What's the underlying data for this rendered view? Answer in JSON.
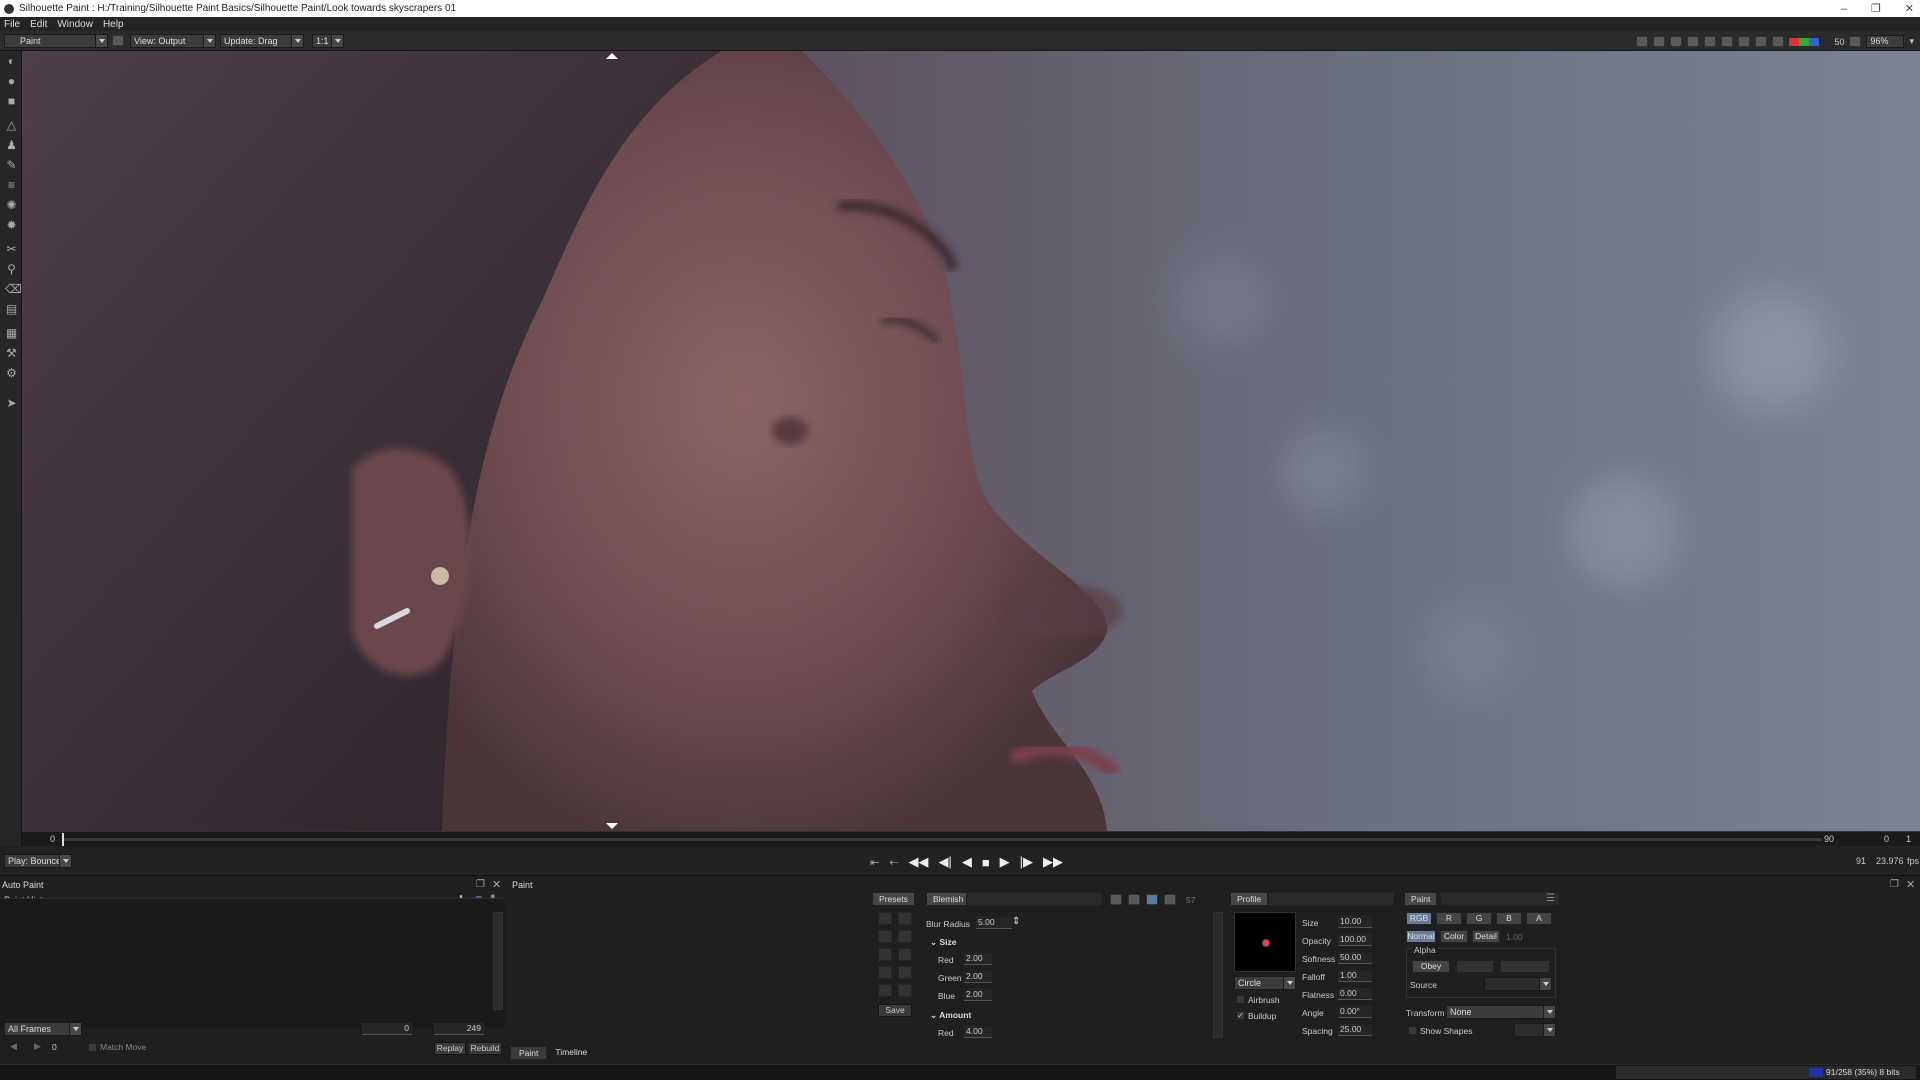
{
  "window": {
    "title": "Silhouette Paint : H:/Training/Silhouette Paint Basics/Silhouette Paint/Look towards skyscrapers 01",
    "controls": [
      "–",
      "❐",
      "✕"
    ]
  },
  "menu": [
    "File",
    "Edit",
    "Window",
    "Help"
  ],
  "toolbar": {
    "mode": "Paint",
    "view": "View: Output",
    "update": "Update: Drag",
    "ratio": "1:1",
    "frame_readout": "50",
    "zoom": "96%"
  },
  "timeline": {
    "start": "0",
    "end_frame": "90",
    "right_a": "0",
    "right_b": "1",
    "current": "91",
    "fps_value": "23.976",
    "fps_unit": "fps"
  },
  "transport": {
    "play_mode": "Play: Bounce"
  },
  "history_panel": {
    "module": "Auto Paint",
    "title": "Paint History",
    "frames_mode": "All Frames",
    "range_start": "0",
    "range_end": "249",
    "frame": "0",
    "match_move": "Match Move",
    "replay": "Replay",
    "rebuild": "Rebuild"
  },
  "paint_panel": {
    "title": "Paint",
    "presets_tab": "Presets",
    "blemish_tab": "Blemish",
    "save": "Save",
    "blur_radius_label": "Blur Radius",
    "blur_radius_value": "5.00",
    "preset_slot": "57",
    "size_section": "Size",
    "size_red_label": "Red",
    "size_red": "2.00",
    "size_green_label": "Green",
    "size_green": "2.00",
    "size_blue_label": "Blue",
    "size_blue": "2.00",
    "amount_section": "Amount",
    "amount_red_label": "Red",
    "amount_red": "4.00"
  },
  "profile_panel": {
    "tab": "Profile",
    "shape": "Circle",
    "airbrush": "Airbrush",
    "buildup": "Buildup",
    "size_label": "Size",
    "size": "10.00",
    "opacity_label": "Opacity",
    "opacity": "100.00",
    "softness_label": "Softness",
    "softness": "50.00",
    "falloff_label": "Falloff",
    "falloff": "1.00",
    "flatness_label": "Flatness",
    "flatness": "0.00",
    "angle_label": "Angle",
    "angle": "0.00°",
    "spacing_label": "Spacing",
    "spacing": "25.00"
  },
  "channels_panel": {
    "tab": "Paint",
    "rgb": "RGB",
    "r": "R",
    "g": "G",
    "b": "B",
    "a": "A",
    "normal": "Normal",
    "color": "Color",
    "detail": "Detail",
    "detail_value": "1.00",
    "alpha_label": "Alpha",
    "obey": "Obey",
    "source_label": "Source",
    "transform_label": "Transform",
    "transform_value": "None",
    "show_shapes": "Show Shapes"
  },
  "bottom_tabs": [
    "Paint",
    "Timeline"
  ],
  "status": {
    "memory": "91/258 (35%) 8 bits"
  },
  "colors": {
    "background": "#1e1e1e",
    "panel": "#1f1f1f",
    "accent_channel": "#6a7a9a",
    "brush_dot": "#ff3355"
  }
}
